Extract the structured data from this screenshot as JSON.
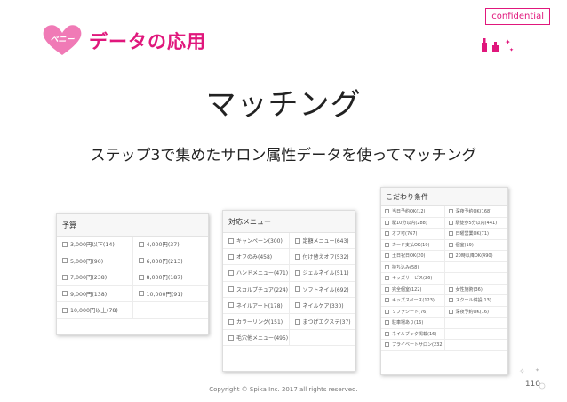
{
  "header": {
    "logo_text": "ペニー",
    "title": "データの応用",
    "confidential": "confidential"
  },
  "main_title": "マッチング",
  "sub_title": "ステップ3で集めたサロン属性データを使ってマッチング",
  "budget_panel": {
    "title": "予算",
    "rows": [
      [
        "3,000円以下(14)",
        "4,000円(37)"
      ],
      [
        "5,000円(90)",
        "6,000円(213)"
      ],
      [
        "7,000円(238)",
        "8,000円(187)"
      ],
      [
        "9,000円(138)",
        "10,000円(91)"
      ],
      [
        "10,000円以上(78)",
        ""
      ]
    ]
  },
  "menu_panel": {
    "title": "対応メニュー",
    "rows": [
      [
        "キャンペーン(300)",
        "定額メニュー(643)"
      ],
      [
        "オフのみ(458)",
        "付け替えオフ(532)"
      ],
      [
        "ハンドメニュー(471)",
        "ジェルネイル(511)"
      ],
      [
        "スカルプチュア(224)",
        "ソフトネイル(692)"
      ],
      [
        "ネイルアート(178)",
        "ネイルケア(330)"
      ],
      [
        "カラーリング(151)",
        "まつげエクステ(37)"
      ],
      [
        "毛穴他メニュー(495)",
        ""
      ]
    ]
  },
  "kodawari_panel": {
    "title": "こだわり条件",
    "rows": [
      [
        "当日予約OK(12)",
        "深夜予約OK(168)"
      ],
      [
        "駅10分以内(288)",
        "駅徒歩5分以内(441)"
      ],
      [
        "オフ可(767)",
        "日曜営業OK(71)"
      ],
      [
        "カード支払OK(19)",
        "個室(19)"
      ],
      [
        "土日祝日OK(20)",
        "20時以降OK(490)"
      ],
      [
        "持ち込み(58)",
        ""
      ],
      [
        "キッズサービス(26)",
        ""
      ],
      [
        "完全個室(122)",
        "女性施術(36)"
      ],
      [
        "キッズスペース(123)",
        "スクール併設(13)"
      ],
      [
        "ソファシート(76)",
        "深夜予約OK(16)"
      ],
      [
        "駐車場あり(16)",
        ""
      ],
      [
        "ネイルブック掲載(16)",
        ""
      ],
      [
        "プライベートサロン(232)",
        ""
      ]
    ]
  },
  "footer": "Copyright © Spika Inc. 2017 all rights reserved.",
  "page_number": "110",
  "colors": {
    "accent": "#e0177c",
    "heart": "#f07ab6"
  }
}
